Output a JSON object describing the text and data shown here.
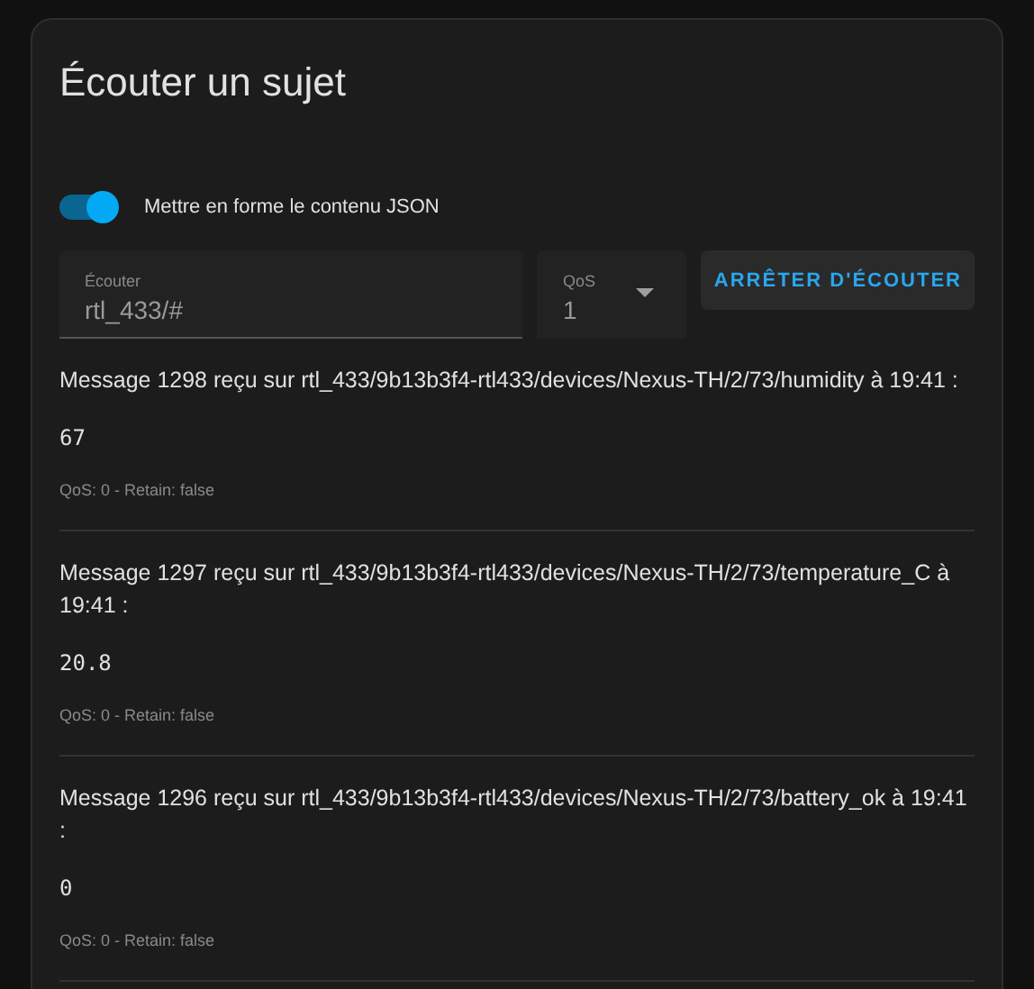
{
  "card": {
    "title": "Écouter un sujet"
  },
  "format_toggle": {
    "label": "Mettre en forme le contenu JSON",
    "on": true
  },
  "topic_field": {
    "label": "Écouter",
    "value": "rtl_433/#"
  },
  "qos_select": {
    "label": "QoS",
    "value": "1"
  },
  "stop_button": "ARRÊTER D'ÉCOUTER",
  "messages": [
    {
      "heading": "Message 1298 reçu sur rtl_433/9b13b3f4-rtl433/devices/Nexus-TH/2/73/humidity à 19:41 :",
      "payload": "67",
      "meta": "QoS: 0 - Retain: false"
    },
    {
      "heading": "Message 1297 reçu sur rtl_433/9b13b3f4-rtl433/devices/Nexus-TH/2/73/temperature_C à 19:41 :",
      "payload": "20.8",
      "meta": "QoS: 0 - Retain: false"
    },
    {
      "heading": "Message 1296 reçu sur rtl_433/9b13b3f4-rtl433/devices/Nexus-TH/2/73/battery_ok à 19:41 :",
      "payload": "0",
      "meta": "QoS: 0 - Retain: false"
    }
  ]
}
